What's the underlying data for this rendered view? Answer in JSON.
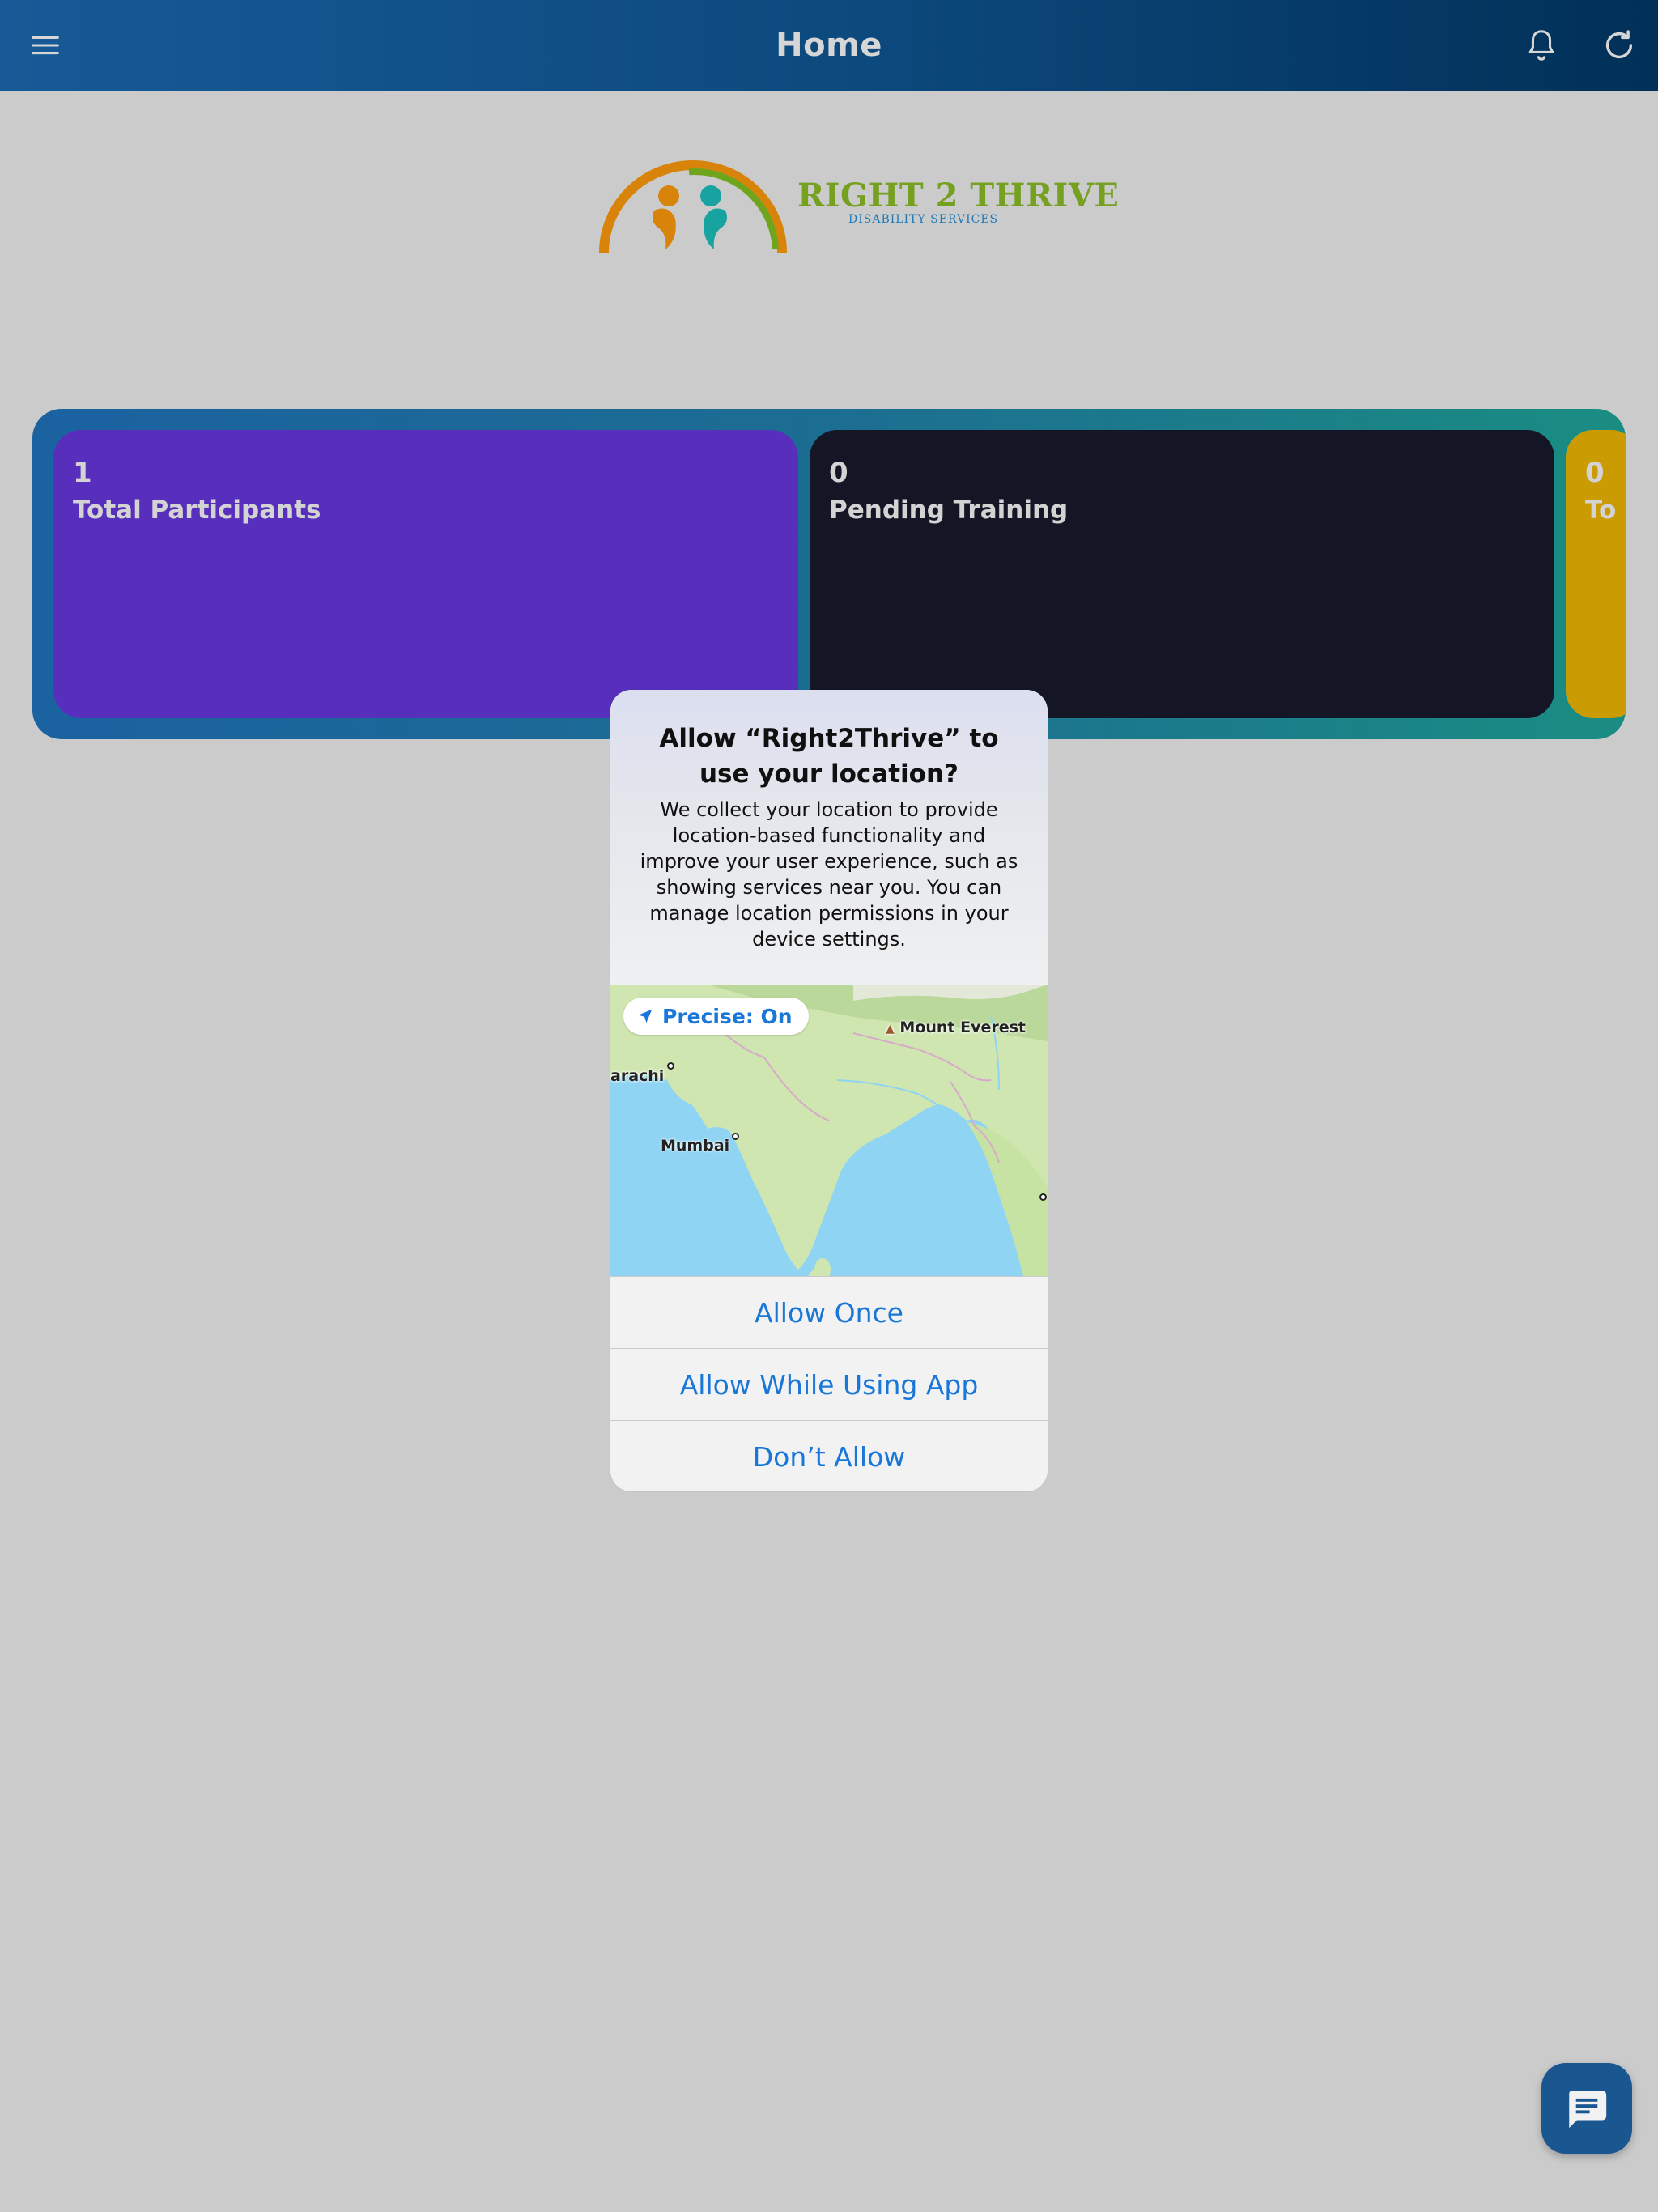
{
  "header": {
    "title": "Home",
    "menu_icon": "menu-icon",
    "bell_icon": "bell-icon",
    "refresh_icon": "refresh-icon"
  },
  "logo": {
    "title": "RIGHT 2 THRIVE",
    "subtitle": "DISABILITY SERVICES"
  },
  "stats": [
    {
      "value": "1",
      "label": "Total Participants",
      "color": "#582fbd"
    },
    {
      "value": "0",
      "label": "Pending Training",
      "color": "#141625"
    },
    {
      "value": "0",
      "label": "To",
      "color": "#cb9b04"
    }
  ],
  "dialog": {
    "title": "Allow “Right2Thrive” to use your location?",
    "message": "We collect your location to provide location-based functionality and improve your user experience, such as showing services near you. You can manage location permissions in your device settings.",
    "precise_label": "Precise: On",
    "map_labels": {
      "everest": "Mount Everest",
      "karachi": "arachi",
      "mumbai": "Mumbai"
    },
    "buttons": {
      "allow_once": "Allow Once",
      "allow_while_using": "Allow While Using App",
      "dont_allow": "Don’t Allow"
    }
  },
  "chat": {
    "icon": "chat-icon"
  },
  "colors": {
    "header_start": "#175a97",
    "header_end": "#013058",
    "accent_blue": "#1877d9",
    "background": "#cbcbcb"
  }
}
